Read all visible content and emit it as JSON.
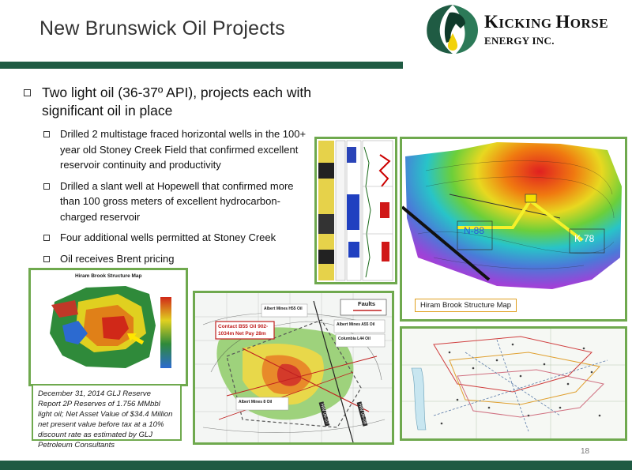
{
  "page": {
    "title": "New Brunswick Oil Projects",
    "page_number": "18"
  },
  "logo": {
    "line1_big1": "K",
    "line1_small1": "ICKING ",
    "line1_big2": "H",
    "line1_small2": "ORSE",
    "line2": "ENERGY INC."
  },
  "bullets": {
    "main": "Two light oil (36-37º API), projects each with significant oil in place",
    "sub": [
      "Drilled 2 multistage fraced horizontal wells in the 100+ year old Stoney Creek Field that confirmed excellent reservoir continuity and productivity",
      "Drilled a slant well at Hopewell that confirmed more than 100 gross meters of excellent hydrocarbon-charged reservoir",
      "Four additional wells permitted at Stoney Creek",
      "Oil receives Brent pricing"
    ]
  },
  "maps": {
    "hiram_small_title": "Hiram Brook Structure Map",
    "hiram_large_label": "Hiram Brook Structure Map",
    "well_n88": "N-88",
    "well_k78": "K-78",
    "faults_legend": "Faults",
    "contact_label_1": "Contact B55   Oil   902-",
    "contact_label_2": "1034m   Net Pay   28m",
    "well_h55": "Albert Mines  H55   Oil",
    "well_a55": "Albert Mines  A55   Oil",
    "well_l44": "Columbia  L44  Oil",
    "well_8": "Albert Mines  8   Oil",
    "hw_1": "HW 06-07",
    "hw_2": "HW 06-08"
  },
  "caption": "December 31, 2014 GLJ Reserve Report 2P Reserves  of 1.756 MMbbl light oil; Net Asset Value of  $34.4 Million net present value before tax at a 10% discount rate as estimated by GLJ Petroleum Consultants",
  "colors": {
    "accent_green": "#1f5b43",
    "frame_green": "#6fa94e"
  }
}
